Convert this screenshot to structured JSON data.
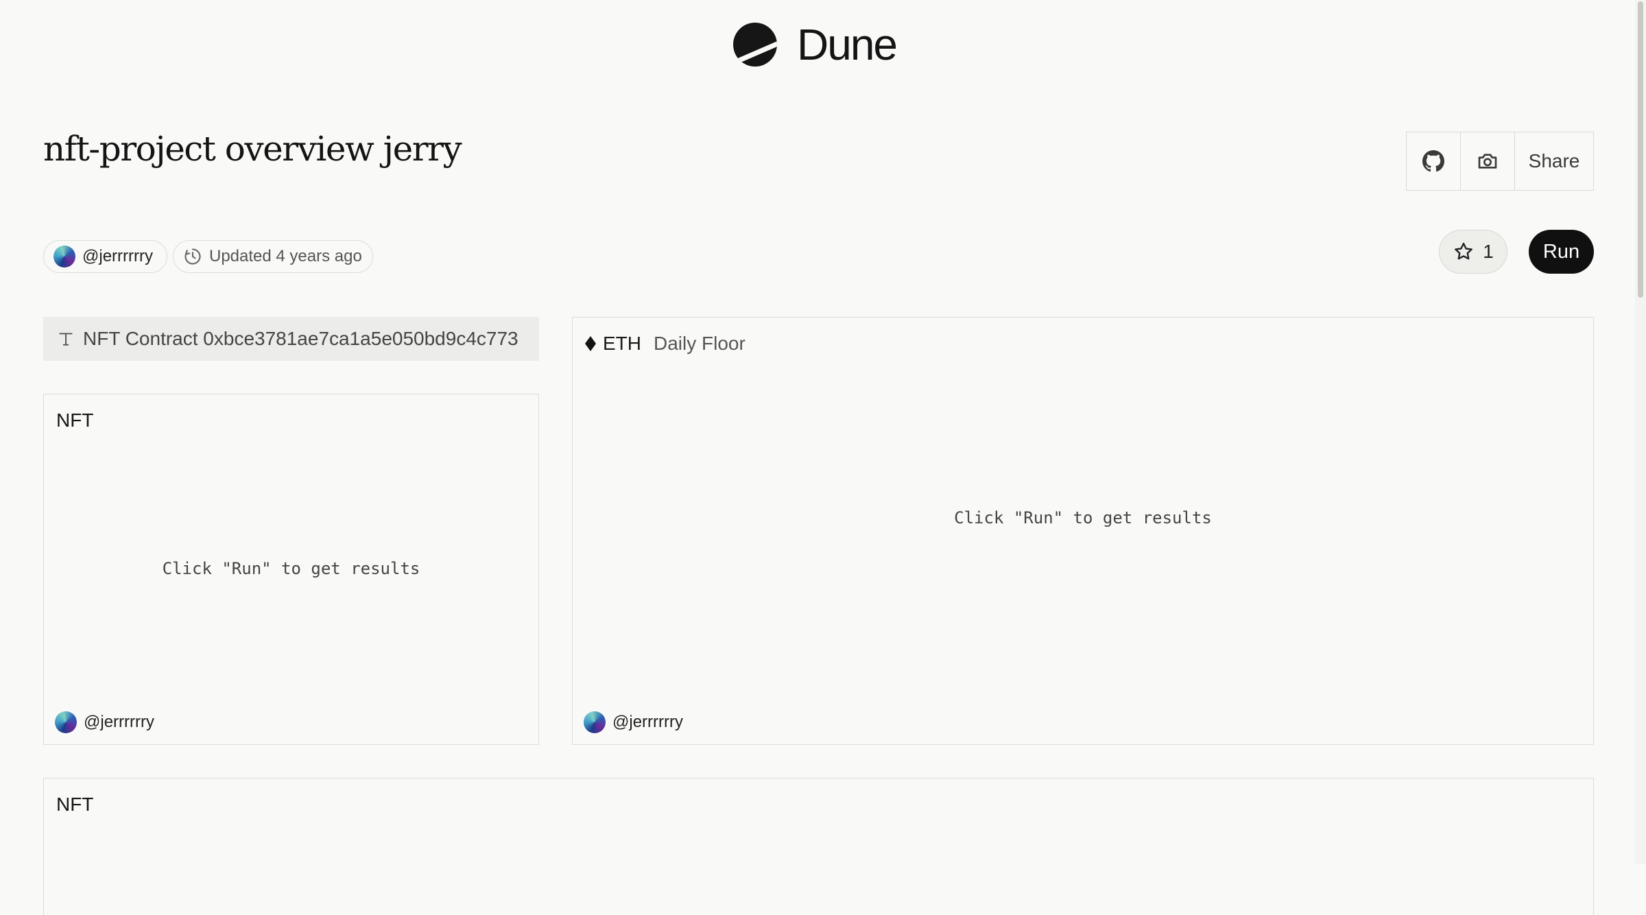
{
  "brand": {
    "name": "Dune"
  },
  "dashboard": {
    "title": "nft-project overview jerry",
    "owner": "@jerrrrrry",
    "updated_label": "Updated 4 years ago",
    "stars": "1"
  },
  "toolbar": {
    "share_label": "Share",
    "run_label": "Run"
  },
  "widgets": {
    "text_widget": {
      "content": "NFT Contract 0xbce3781ae7ca1a5e050bd9c4c773"
    },
    "nft_card": {
      "title": "NFT",
      "placeholder": "Click \"Run\" to get results",
      "owner": "@jerrrrrry"
    },
    "eth_card": {
      "symbol": "ETH",
      "subtitle": "Daily Floor",
      "placeholder": "Click \"Run\" to get results",
      "owner": "@jerrrrrry"
    },
    "nft_card_2": {
      "title": "NFT"
    }
  },
  "icons": {
    "logo": "dune-logo-icon",
    "github": "github-icon",
    "camera": "camera-icon",
    "clock": "clock-icon",
    "star": "star-icon",
    "text": "text-icon",
    "eth": "eth-diamond-icon"
  },
  "colors": {
    "background": "#f9f9f7",
    "run_button": "#101010",
    "border": "#dcdcd8"
  }
}
